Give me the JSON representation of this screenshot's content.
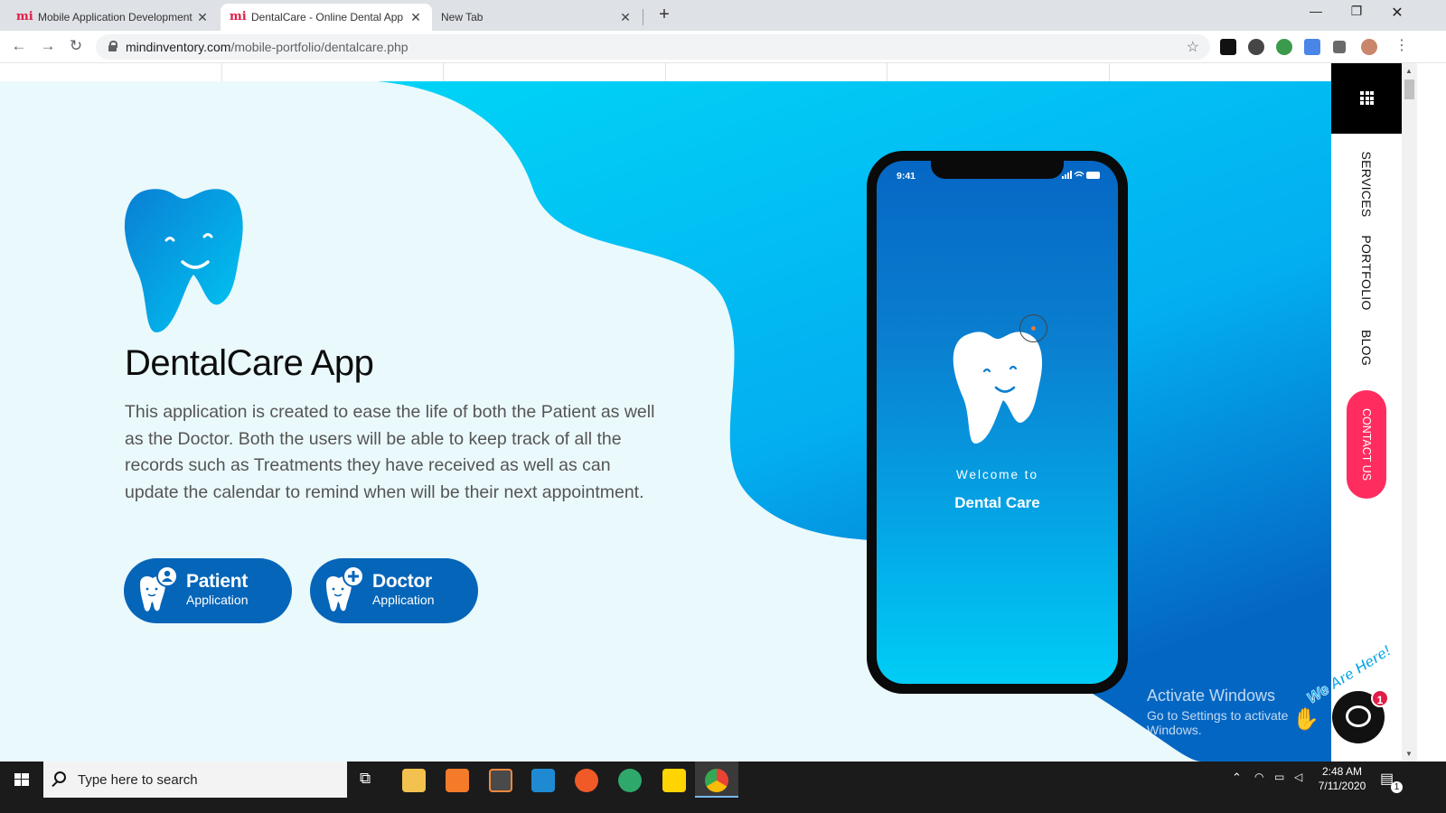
{
  "browser": {
    "tabs": [
      {
        "title": "Mobile Application Development",
        "favicon": "mi-logo-icon",
        "active": false
      },
      {
        "title": "DentalCare - Online Dental App",
        "favicon": "mi-logo-icon",
        "active": true
      },
      {
        "title": "New Tab",
        "favicon": "",
        "active": false
      }
    ],
    "favicon_glyph": "mi",
    "url_host": "mindinventory.com",
    "url_path": "/mobile-portfolio/dentalcare.php"
  },
  "hero": {
    "title": "DentalCare App",
    "description": "This application is created to ease the life of both the Patient as well as the Doctor. Both the users will be able to keep track of all the records such as Treatments they have received as well as can update the calendar to remind when will be their next appointment.",
    "buttons": [
      {
        "title": "Patient",
        "subtitle": "Application",
        "badge_icon": "user-icon"
      },
      {
        "title": "Doctor",
        "subtitle": "Application",
        "badge_icon": "plus-icon"
      }
    ]
  },
  "phone": {
    "time": "9:41",
    "welcome": "Welcome to",
    "app_name": "Dental Care"
  },
  "sidenav": {
    "links": [
      "SERVICES",
      "PORTFOLIO",
      "BLOG"
    ],
    "contact": "CONTACT US"
  },
  "chat": {
    "badge": "1",
    "tagline": "We Are Here!"
  },
  "watermark": {
    "line1": "Activate Windows",
    "line2": "Go to Settings to activate Windows."
  },
  "taskbar": {
    "search_placeholder": "Type here to search",
    "time": "2:48 AM",
    "date": "7/11/2020",
    "notification_count": "1"
  },
  "colors": {
    "brand_blue": "#0565b9",
    "cyan": "#00d4f7",
    "contact_pink": "#ff2d5f",
    "page_bg": "#eaf9fc"
  }
}
